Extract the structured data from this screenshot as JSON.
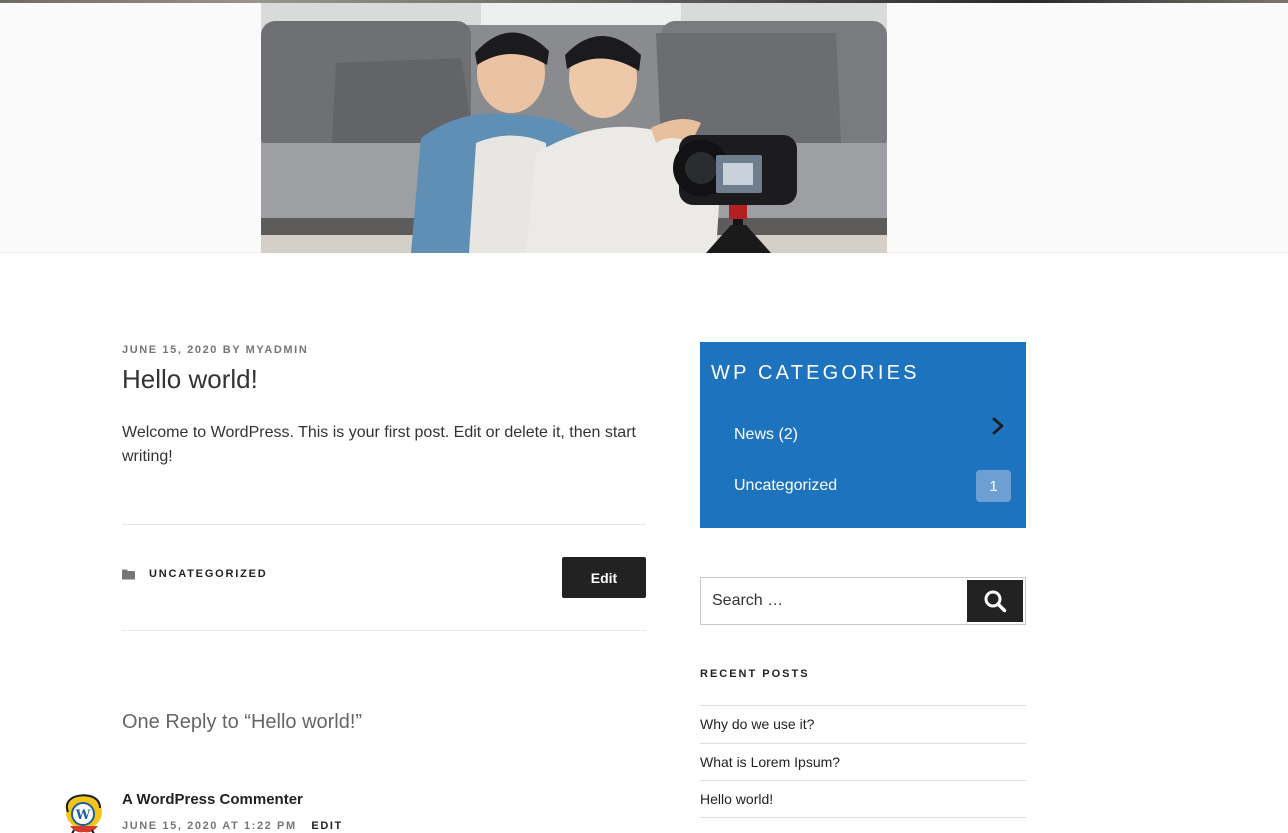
{
  "post": {
    "date": "JUNE 15, 2020",
    "by": "BY",
    "author": "MYADMIN",
    "title": "Hello world!",
    "body": "Welcome to WordPress. This is your first post. Edit or delete it, then start writing!",
    "category": "UNCATEGORIZED",
    "edit_label": "Edit"
  },
  "comments": {
    "title": "One Reply to “Hello world!”",
    "items": [
      {
        "author": "A WordPress Commenter",
        "date": "JUNE 15, 2020 AT 1:22 PM",
        "edit_label": "EDIT"
      }
    ]
  },
  "sidebar": {
    "categories_widget": {
      "title": "WP CATEGORIES",
      "items": [
        {
          "label": "News (2)"
        },
        {
          "label": "Uncategorized",
          "count": "1"
        }
      ],
      "background": "#1e73be"
    },
    "search": {
      "placeholder": "Search …"
    },
    "recent_posts": {
      "title": "RECENT POSTS",
      "items": [
        "Why do we use it?",
        "What is Lorem Ipsum?",
        "Hello world!"
      ]
    }
  },
  "icons": {
    "category": "folder-icon",
    "search": "search-icon",
    "chevron": "chevron-right-icon",
    "avatar": "wordpress-avatar-icon"
  }
}
